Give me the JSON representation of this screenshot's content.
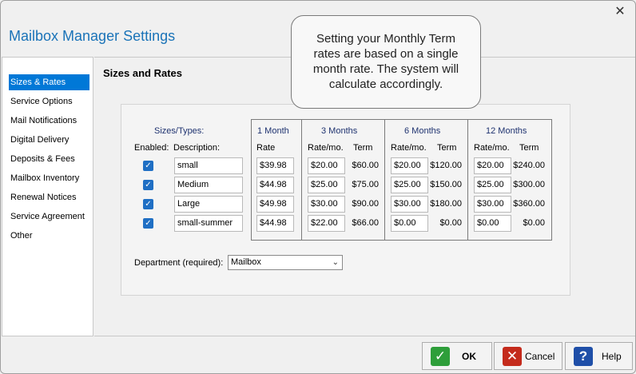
{
  "window": {
    "title": "Mailbox Manager Settings",
    "close": "✕"
  },
  "sidebar": {
    "items": [
      {
        "label": "Sizes & Rates",
        "selected": true
      },
      {
        "label": "Service Options"
      },
      {
        "label": "Mail Notifications"
      },
      {
        "label": "Digital Delivery"
      },
      {
        "label": "Deposits & Fees"
      },
      {
        "label": "Mailbox Inventory"
      },
      {
        "label": "Renewal Notices"
      },
      {
        "label": "Service Agreement"
      },
      {
        "label": "Other"
      }
    ]
  },
  "main": {
    "section_title": "Sizes and Rates",
    "headers": {
      "sizes_types": "Sizes/Types:",
      "enabled": "Enabled:",
      "description": "Description:",
      "one_month": "1 Month",
      "rate": "Rate",
      "three_months": "3 Months",
      "six_months": "6 Months",
      "twelve_months": "12 Months",
      "rate_mo": "Rate/mo.",
      "term": "Term"
    },
    "rows": [
      {
        "enabled": true,
        "description": "small",
        "rate1": "$39.98",
        "rate3": "$20.00",
        "term3": "$60.00",
        "rate6": "$20.00",
        "term6": "$120.00",
        "rate12": "$20.00",
        "term12": "$240.00"
      },
      {
        "enabled": true,
        "description": "Medium",
        "rate1": "$44.98",
        "rate3": "$25.00",
        "term3": "$75.00",
        "rate6": "$25.00",
        "term6": "$150.00",
        "rate12": "$25.00",
        "term12": "$300.00"
      },
      {
        "enabled": true,
        "description": "Large",
        "rate1": "$49.98",
        "rate3": "$30.00",
        "term3": "$90.00",
        "rate6": "$30.00",
        "term6": "$180.00",
        "rate12": "$30.00",
        "term12": "$360.00"
      },
      {
        "enabled": true,
        "description": "small-summer",
        "rate1": "$44.98",
        "rate3": "$22.00",
        "term3": "$66.00",
        "rate6": "$0.00",
        "term6": "$0.00",
        "rate12": "$0.00",
        "term12": "$0.00"
      }
    ],
    "department_label": "Department (required):",
    "department_value": "Mailbox"
  },
  "tooltip": {
    "text": "Setting your Monthly Term rates are based on a single month rate. The system will calculate accordingly."
  },
  "footer": {
    "ok": "OK",
    "cancel": "Cancel",
    "help": "Help"
  },
  "colors": {
    "accent": "#0078d7",
    "title": "#1a73b8",
    "ok_icon": "#2e9e3a",
    "cancel_icon": "#c42b1c",
    "help_icon": "#1f4fa8"
  }
}
